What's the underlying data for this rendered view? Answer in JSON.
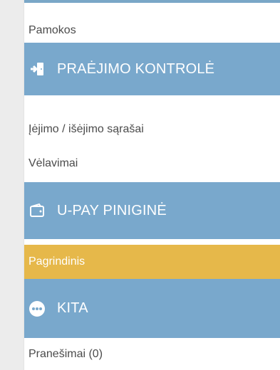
{
  "sidebar": {
    "items": [
      {
        "kind": "link",
        "label": "Pamokos"
      },
      {
        "kind": "section",
        "label": "PRAĖJIMO KONTROLĖ",
        "icon": "door-exit-icon"
      },
      {
        "kind": "link",
        "label": "Įėjimo / išėjimo sąrašai"
      },
      {
        "kind": "link",
        "label": "Vėlavimai"
      },
      {
        "kind": "section",
        "label": "U-PAY PINIGINĖ",
        "icon": "wallet-icon"
      },
      {
        "kind": "link",
        "label": "Pagrindinis",
        "active": true
      },
      {
        "kind": "section",
        "label": "KITA",
        "icon": "more-dots-icon"
      },
      {
        "kind": "link",
        "label": "Pranešimai (0)"
      }
    ]
  },
  "colors": {
    "section_bg": "#79a8cc",
    "active_bg": "#e6b84a",
    "link_text": "#4b4b4b",
    "page_bg": "#ececec"
  }
}
